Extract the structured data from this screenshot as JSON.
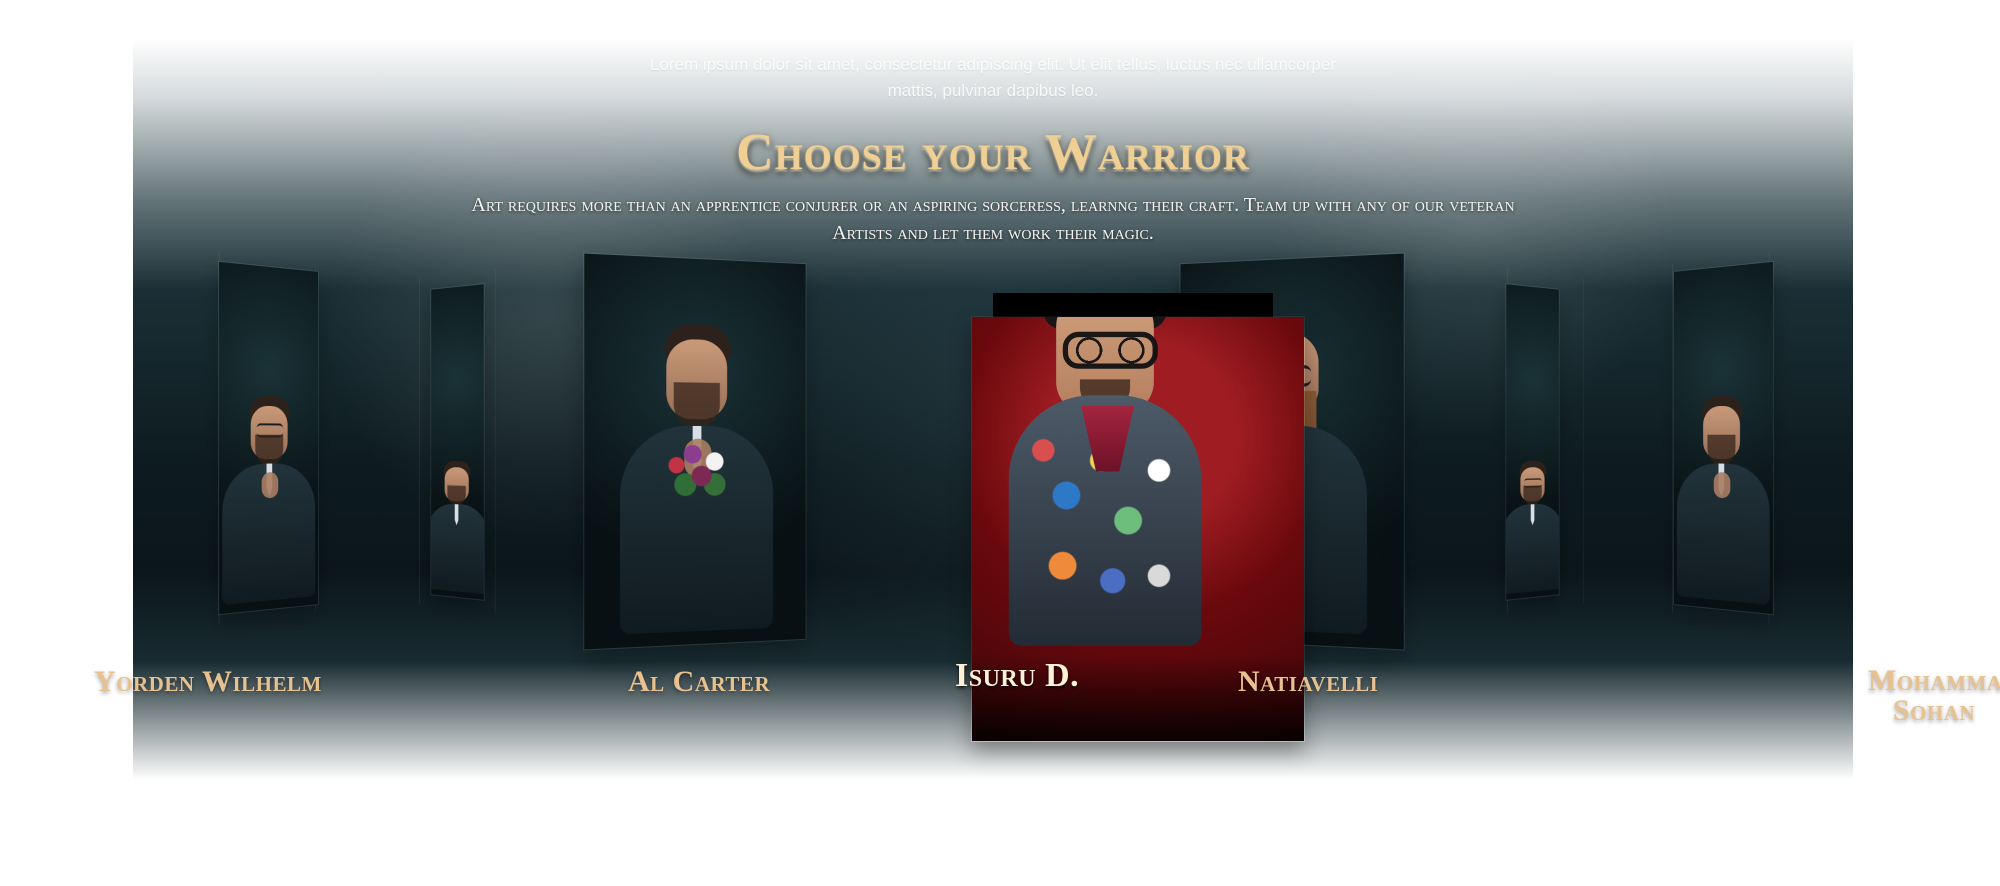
{
  "hero": {
    "intro": "Lorem ipsum dolor sit amet, consectetur adipiscing elit. Ut elit tellus, luctus nec ullamcorper mattis, pulvinar dapibus leo.",
    "title": "Choose your Warrior",
    "subtitle": "Art requires more than an apprentice conjurer or an aspiring sorceress, learnng their craft. Team up with any of our veteran Artists and let them work their magic."
  },
  "cards": [
    {
      "name": "Yorden Wilhelm",
      "icon": "portrait-man-sunglasses"
    },
    {
      "name": "Al Carter",
      "icon": "portrait-man-flowers"
    },
    {
      "name": "Isuru D.",
      "icon": "portrait-man-patches-glasses"
    },
    {
      "name": "Natiavelli",
      "icon": "portrait-bald-bearded-man"
    },
    {
      "name": "Mohamma\nSohan",
      "icon": "portrait-man-dark-suit"
    }
  ],
  "colors": {
    "background": "#0f1d22",
    "accent_gold": "#e7c18f",
    "title_gold": "#efcf93",
    "center_red": "#9f1d22"
  }
}
